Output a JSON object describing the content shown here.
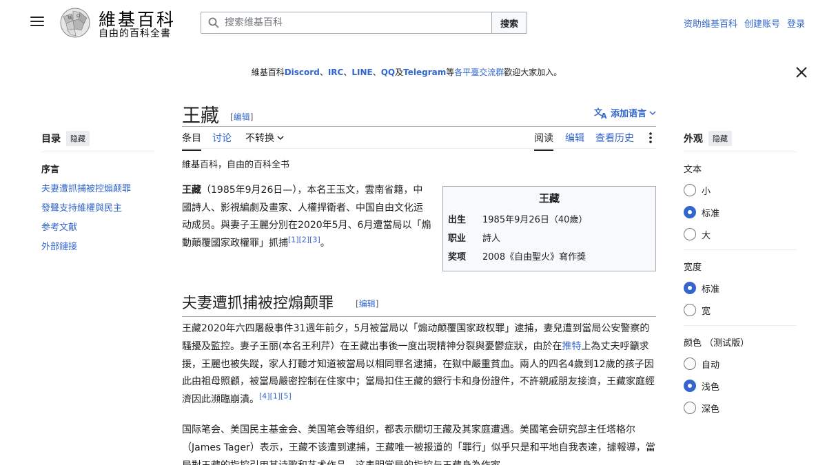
{
  "header": {
    "logo_title": "維基百科",
    "logo_tagline": "自由的百科全書",
    "search_placeholder": "搜索维基百科",
    "search_button": "搜索",
    "user_links": [
      "资助维基百科",
      "创建账号",
      "登录"
    ]
  },
  "sitenotice": {
    "prefix": "維基百科",
    "items": [
      "Discord",
      "IRC",
      "LINE",
      "QQ",
      "Telegram"
    ],
    "sep1": "、",
    "and": "及",
    "deng": "等",
    "link": "各平臺交流群",
    "suffix": "歡迎大家加入。"
  },
  "toc": {
    "title": "目录",
    "hide": "隐藏",
    "items": [
      "序言",
      "夫妻遭抓捕被控煽颠罪",
      "發聲支持維權與民主",
      "参考文献",
      "外部鏈接"
    ]
  },
  "page": {
    "title": "王藏",
    "edit_open": "[",
    "edit": "编辑",
    "edit_close": "]",
    "add_language": "添加语言",
    "tabs_left": [
      "条目",
      "讨论",
      "不转换"
    ],
    "tabs_right": [
      "阅读",
      "编辑",
      "查看历史"
    ],
    "tagline": "維基百科，自由的百科全书"
  },
  "infobox": {
    "title": "王藏",
    "rows": [
      {
        "k": "出生",
        "v": "1985年9月26日（40歲）"
      },
      {
        "k": "职业",
        "v": "詩人"
      },
      {
        "k": "奖项",
        "v": "2008《自由聖火》寫作獎"
      }
    ]
  },
  "lead": {
    "name": "王藏",
    "text": "（1985年9月26日—），本名王玉文，雲南省籍，中國詩人、影視編劇及畫家、人權捍衛者、中国自由文化运动成员。與妻子王麗分別在2020年5月、6月遭當局以「煽動顛覆國家政權罪」抓捕",
    "refs": "[1][2][3]",
    "end": "。"
  },
  "section1": {
    "title": "夫妻遭抓捕被控煽颠罪",
    "edit": "编辑",
    "p1_a": "王藏2020年六四屠殺事件31週年前夕，5月被當局以「煽动颠覆国家政权罪」逮捕，妻兒遭到當局公安警察的騷擾及監控。妻子王丽(本名王利芹）在王藏出事後一度出現精神分裂與憂鬱症狀，由於在",
    "p1_link": "推特",
    "p1_b": "上為丈夫呼籲求援，王麗也被失蹤，家人打聽才知道被當局以相同罪名逮捕，在獄中嚴重貧血。兩人的四名4歲到12歲的孩子因此由祖母照顧，被當局嚴密控制在住家中；當局扣住王藏的銀行卡和身份證件，不許親戚朋友接濟，王藏家庭經濟因此瀕臨崩潰。",
    "p1_refs": "[4][1][5]",
    "p2": "国际笔会、美国民主基金会、美国笔会等组织，都表示關切王藏及其家庭遭遇。美國笔会研究部主任塔格尔（James Tager）表示，王藏不该遭到逮捕，王藏唯一被报道的「罪行」似乎只是和平地自我表達，據報導，當局對王藏的指控引用其诗歌和艺术作品，这表明當局的指控与王藏身為作家"
  },
  "appearance": {
    "title": "外观",
    "hide": "隐藏",
    "groups": [
      {
        "label": "文本",
        "options": [
          "小",
          "标准",
          "大"
        ],
        "selected": 1
      },
      {
        "label": "宽度",
        "options": [
          "标准",
          "宽"
        ],
        "selected": 0
      },
      {
        "label": "颜色 （测试版）",
        "options": [
          "自动",
          "浅色",
          "深色"
        ],
        "selected": 1
      }
    ]
  },
  "colors": {
    "link": "#3366cc",
    "text": "#202122",
    "border": "#a2a9b1"
  }
}
